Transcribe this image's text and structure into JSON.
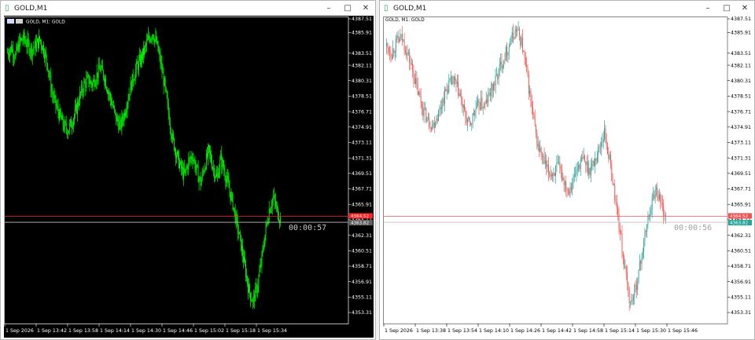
{
  "left": {
    "title": "GOLD,M1",
    "chart_label": "GOLD, M1:  GOLD",
    "countdown": "00:00:57",
    "price_tag_upper": "4364.52",
    "price_tag_lower": "4363.82",
    "price_axis": [
      "4387.51",
      "4385.91",
      "4383.51",
      "4382.11",
      "4380.31",
      "4378.51",
      "4376.71",
      "4374.91",
      "4373.11",
      "4371.31",
      "4369.51",
      "4367.71",
      "4365.91",
      "4364.11",
      "4362.31",
      "4360.51",
      "4358.71",
      "4356.91",
      "4355.11",
      "4353.31"
    ],
    "time_axis": [
      "1 Sep 2026",
      "1 Sep 13:42",
      "1 Sep 13:58",
      "1 Sep 14:14",
      "1 Sep 14:30",
      "1 Sep 14:46",
      "1 Sep 15:02",
      "1 Sep 15:18",
      "1 Sep 15:34"
    ],
    "colors": {
      "background": "#000000",
      "candle": "#00ff00",
      "axis_text": "#ffffff",
      "grid": "#ffffff"
    }
  },
  "right": {
    "title": "GOLD,M1",
    "chart_label": "GOLD, M1:  GOLD",
    "countdown": "00:00:56",
    "price_tag_upper": "4364.52",
    "price_tag_lower": "4363.82",
    "price_axis": [
      "4387.51",
      "4385.91",
      "4383.51",
      "4382.11",
      "4380.31",
      "4378.51",
      "4376.71",
      "4374.91",
      "4373.11",
      "4371.31",
      "4369.51",
      "4367.71",
      "4365.91",
      "4364.11",
      "4362.31",
      "4360.51",
      "4358.71",
      "4356.91",
      "4355.11",
      "4353.31"
    ],
    "time_axis": [
      "1 Sep 2026",
      "1 Sep 13:38",
      "1 Sep 13:54",
      "1 Sep 14:10",
      "1 Sep 14:26",
      "1 Sep 14:42",
      "1 Sep 14:58",
      "1 Sep 15:14",
      "1 Sep 15:30",
      "1 Sep 15:46"
    ],
    "colors": {
      "background": "#ffffff",
      "bull": "#26a69a",
      "bear": "#ef5350",
      "axis_text": "#000000"
    }
  },
  "window_buttons": {
    "minimize": "–",
    "maximize": "□",
    "close": "✕"
  },
  "icons": {
    "chart": "chart-icon",
    "flag": "flag-icon"
  },
  "chart_data": [
    {
      "type": "candlestick",
      "symbol": "GOLD",
      "timeframe": "M1",
      "y_tick_labels": [
        "4387.51",
        "4385.91",
        "4383.51",
        "4382.11",
        "4380.31",
        "4378.51",
        "4376.71",
        "4374.91",
        "4373.11",
        "4371.31",
        "4369.51",
        "4367.71",
        "4365.91",
        "4364.11",
        "4362.31",
        "4360.51",
        "4358.71",
        "4356.91",
        "4355.11",
        "4353.31"
      ],
      "x_tick_labels": [
        "1 Sep 2026",
        "1 Sep 13:42",
        "1 Sep 13:58",
        "1 Sep 14:14",
        "1 Sep 14:30",
        "1 Sep 14:46",
        "1 Sep 15:02",
        "1 Sep 15:18",
        "1 Sep 15:34"
      ],
      "current_bid": 4363.82,
      "current_ask": 4364.52,
      "price_path": [
        4383.6,
        4384.1,
        4383.2,
        4384.8,
        4385.2,
        4384.5,
        4383.9,
        4384.4,
        4385.1,
        4384.0,
        4382.2,
        4379.0,
        4377.5,
        4376.2,
        4375.0,
        4374.6,
        4375.5,
        4376.8,
        4378.5,
        4379.8,
        4380.4,
        4379.9,
        4380.8,
        4381.7,
        4380.9,
        4379.1,
        4377.6,
        4375.9,
        4375.0,
        4376.4,
        4378.5,
        4380.3,
        4381.8,
        4382.7,
        4383.8,
        4385.1,
        4385.9,
        4384.7,
        4382.5,
        4379.8,
        4376.5,
        4373.5,
        4371.8,
        4370.2,
        4369.3,
        4370.9,
        4371.6,
        4369.8,
        4368.4,
        4370.5,
        4372.1,
        4370.4,
        4368.9,
        4371.2,
        4369.6,
        4367.8,
        4366.0,
        4363.5,
        4361.2,
        4358.5,
        4355.9,
        4354.6,
        4356.2,
        4359.0,
        4362.4,
        4365.3,
        4366.7,
        4365.1,
        4364.0
      ]
    },
    {
      "type": "candlestick",
      "symbol": "GOLD",
      "timeframe": "M1",
      "y_tick_labels": [
        "4387.51",
        "4385.91",
        "4383.51",
        "4382.11",
        "4380.31",
        "4378.51",
        "4376.71",
        "4374.91",
        "4373.11",
        "4371.31",
        "4369.51",
        "4367.71",
        "4365.91",
        "4364.11",
        "4362.31",
        "4360.51",
        "4358.71",
        "4356.91",
        "4355.11",
        "4353.31"
      ],
      "x_tick_labels": [
        "1 Sep 2026",
        "1 Sep 13:38",
        "1 Sep 13:54",
        "1 Sep 14:10",
        "1 Sep 14:26",
        "1 Sep 14:42",
        "1 Sep 14:58",
        "1 Sep 15:14",
        "1 Sep 15:30",
        "1 Sep 15:46"
      ],
      "current_bid": 4363.82,
      "current_ask": 4364.52,
      "price_path": [
        4384.3,
        4383.6,
        4384.9,
        4385.2,
        4383.5,
        4381.5,
        4379.0,
        4377.0,
        4375.6,
        4375.2,
        4376.6,
        4378.4,
        4379.9,
        4380.2,
        4378.8,
        4376.4,
        4375.0,
        4376.8,
        4377.6,
        4377.4,
        4379.0,
        4380.3,
        4382.1,
        4383.6,
        4385.0,
        4386.3,
        4384.8,
        4381.2,
        4377.0,
        4373.1,
        4371.3,
        4369.8,
        4369.5,
        4370.3,
        4369.0,
        4367.6,
        4368.8,
        4370.5,
        4371.1,
        4369.9,
        4370.8,
        4372.5,
        4374.3,
        4371.0,
        4366.9,
        4362.8,
        4358.0,
        4354.3,
        4356.1,
        4359.3,
        4362.9,
        4366.0,
        4367.9,
        4365.9,
        4364.0
      ]
    }
  ]
}
